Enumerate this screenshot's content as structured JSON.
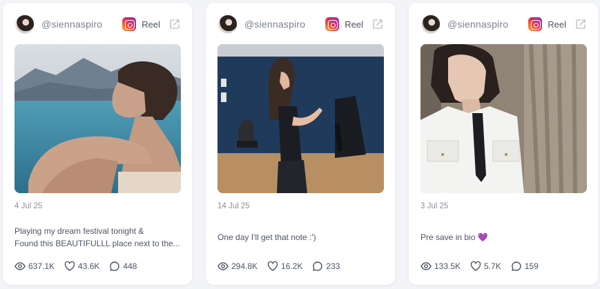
{
  "posts": [
    {
      "username": "@siennaspiro",
      "platform_label": "Reel",
      "date": "4 Jul 25",
      "caption_line1": "Playing my dream festival tonight &",
      "caption_line2": "Found this BEAUTIFULLL place next to the...",
      "views": "637.1K",
      "likes": "43.6K",
      "comments": "448"
    },
    {
      "username": "@siennaspiro",
      "platform_label": "Reel",
      "date": "14 Jul 25",
      "caption_line1": "One day I'll get that note :')",
      "caption_line2": "",
      "views": "294.8K",
      "likes": "16.2K",
      "comments": "233"
    },
    {
      "username": "@siennaspiro",
      "platform_label": "Reel",
      "date": "3 Jul 25",
      "caption_line1": "Pre save in bio 💜",
      "caption_line2": "",
      "views": "133.5K",
      "likes": "5.7K",
      "comments": "159"
    }
  ],
  "icons": {
    "platform": "instagram-icon",
    "external": "external-link-icon",
    "views": "eye-icon",
    "likes": "heart-icon",
    "comments": "comment-icon"
  },
  "colors": {
    "background": "#f3f4f7",
    "card": "#ffffff",
    "muted_text": "#8a909c",
    "body_text": "#4b5563"
  }
}
